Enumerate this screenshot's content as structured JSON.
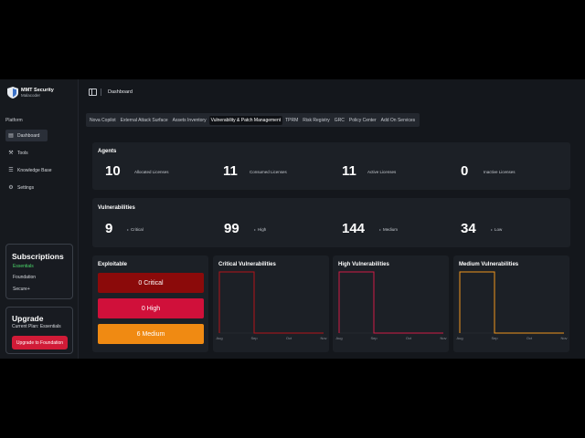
{
  "brand": {
    "name": "MMT Security",
    "subtitle": "Malacoder"
  },
  "sidebar": {
    "section_label": "Platform",
    "items": [
      {
        "label": "Dashboard",
        "icon": "dashboard-icon",
        "active": true
      },
      {
        "label": "Tools",
        "icon": "tools-icon",
        "active": false
      },
      {
        "label": "Knowledge Base",
        "icon": "book-icon",
        "active": false
      },
      {
        "label": "Settings",
        "icon": "gear-icon",
        "active": false
      }
    ],
    "subscriptions": {
      "title": "Subscriptions",
      "plans": [
        "Essentials",
        "Foundation",
        "Secure+"
      ],
      "current_index": 0
    },
    "upgrade": {
      "title": "Upgrade",
      "current_plan": "Current Plan: Essentials",
      "button_label": "Upgrade to Foundation"
    }
  },
  "header": {
    "breadcrumb": "Dashboard"
  },
  "tabs": [
    {
      "label": "Nova Copilot",
      "active": false
    },
    {
      "label": "External Attack Surface",
      "active": false
    },
    {
      "label": "Assets Inventory",
      "active": false
    },
    {
      "label": "Vulnerability & Patch Management",
      "active": true
    },
    {
      "label": "TPRM",
      "active": false
    },
    {
      "label": "Risk Registry",
      "active": false
    },
    {
      "label": "GRC",
      "active": false
    },
    {
      "label": "Policy Center",
      "active": false
    },
    {
      "label": "Add On Services",
      "active": false
    }
  ],
  "agents": {
    "title": "Agents",
    "metrics": [
      {
        "value": "10",
        "label": "Allocated Licenses"
      },
      {
        "value": "11",
        "label": "Consumed Licenses"
      },
      {
        "value": "11",
        "label": "Active Licenses"
      },
      {
        "value": "0",
        "label": "Inactive Licenses"
      }
    ]
  },
  "vulnerabilities": {
    "title": "Vulnerabilities",
    "metrics": [
      {
        "value": "9",
        "label": "Critical"
      },
      {
        "value": "99",
        "label": "High"
      },
      {
        "value": "144",
        "label": "Medium"
      },
      {
        "value": "34",
        "label": "Low"
      }
    ]
  },
  "exploitable": {
    "title": "Exploitable",
    "rows": [
      {
        "label": "0 Critical",
        "color": "#8b0a0a"
      },
      {
        "label": "0 High",
        "color": "#d0103a"
      },
      {
        "label": "6 Medium",
        "color": "#f08a12"
      }
    ]
  },
  "chart_data": [
    {
      "type": "line",
      "title": "Critical Vulnerabilities",
      "categories": [
        "Aug",
        "Sep",
        "Oct",
        "Nov"
      ],
      "values": [
        9,
        0,
        0,
        0
      ],
      "color": "#b3131b"
    },
    {
      "type": "line",
      "title": "High Vulnerabilities",
      "categories": [
        "Aug",
        "Sep",
        "Oct",
        "Nov"
      ],
      "values": [
        99,
        0,
        0,
        0
      ],
      "color": "#d11d45"
    },
    {
      "type": "line",
      "title": "Medium Vulnerabilities",
      "categories": [
        "Aug",
        "Sep",
        "Oct",
        "Nov"
      ],
      "values": [
        144,
        0,
        0,
        0
      ],
      "color": "#f0961e"
    }
  ]
}
